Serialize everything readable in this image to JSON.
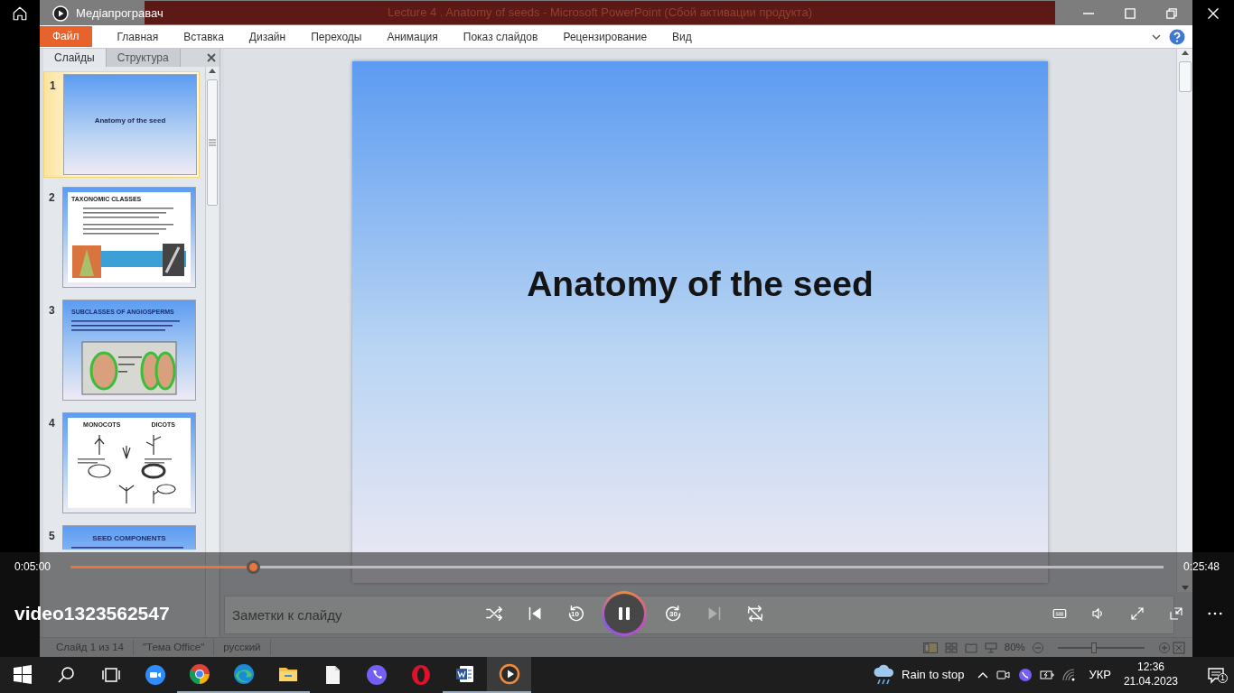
{
  "player": {
    "title": "Медіапрогравач",
    "video_title": "video1323562547",
    "elapsed": "0:05:00",
    "duration": "0:25:48",
    "level": 0.167,
    "playing": true,
    "controls": [
      {
        "kind": "shuffle",
        "disabled": false
      },
      {
        "kind": "previous",
        "disabled": false
      },
      {
        "kind": "rewind",
        "label": "10",
        "disabled": false
      },
      {
        "kind": "playpause",
        "disabled": false
      },
      {
        "kind": "forward",
        "label": "30",
        "disabled": false
      },
      {
        "kind": "next",
        "disabled": true
      },
      {
        "kind": "repeat",
        "disabled": false
      }
    ],
    "tools": [
      {
        "kind": "subtitles"
      },
      {
        "kind": "volume"
      },
      {
        "kind": "fullscreen"
      },
      {
        "kind": "miniplayer"
      },
      {
        "kind": "more"
      }
    ]
  },
  "recording": {
    "window_title": "Lecture 4 . Anatomy of seeds  -  Microsoft PowerPoint (Сбой активации продукта)",
    "ribbon_tabs": [
      {
        "label": "Файл",
        "kind": "file"
      },
      {
        "label": "Главная",
        "kind": "tab"
      },
      {
        "label": "Вставка",
        "kind": "tab"
      },
      {
        "label": "Дизайн",
        "kind": "tab"
      },
      {
        "label": "Переходы",
        "kind": "tab"
      },
      {
        "label": "Анимация",
        "kind": "tab"
      },
      {
        "label": "Показ слайдов",
        "kind": "tab"
      },
      {
        "label": "Рецензирование",
        "kind": "tab"
      },
      {
        "label": "Вид",
        "kind": "tab"
      }
    ],
    "panel_tabs": [
      {
        "label": "Слайды",
        "selected": true
      },
      {
        "label": "Структура",
        "selected": false
      }
    ],
    "slides": [
      {
        "number": "1",
        "selected": true,
        "kind": "title",
        "headings": [
          "Anatomy  of the seed"
        ]
      },
      {
        "number": "2",
        "selected": false,
        "kind": "text-photos",
        "headings": [
          "TAXONOMIC CLASSES"
        ]
      },
      {
        "number": "3",
        "selected": false,
        "kind": "diagram",
        "headings": [
          "SUBCLASSES OF ANGIOSPERMS"
        ]
      },
      {
        "number": "4",
        "selected": false,
        "kind": "sketch",
        "headings": [
          "MONOCOTS",
          "DICOTS"
        ]
      },
      {
        "number": "5",
        "selected": false,
        "kind": "bullets",
        "headings": [
          "SEED COMPONENTS"
        ]
      }
    ],
    "current_slide": {
      "title": "Anatomy of the seed"
    },
    "notes": {
      "placeholder": "Заметки к слайду"
    },
    "status_items": [
      "Слайд 1 из 14",
      "\"Тема Office\"",
      "русский"
    ],
    "zoom": {
      "label": "80%",
      "level": 0.42
    }
  },
  "taskbar": {
    "apps": [
      {
        "kind": "start",
        "running": false,
        "active": false
      },
      {
        "kind": "search",
        "running": false,
        "active": false
      },
      {
        "kind": "taskview",
        "running": false,
        "active": false
      },
      {
        "kind": "zoom",
        "running": false,
        "active": false
      },
      {
        "kind": "chrome",
        "running": true,
        "active": false
      },
      {
        "kind": "edge",
        "running": true,
        "active": false
      },
      {
        "kind": "explorer",
        "running": true,
        "active": false
      },
      {
        "kind": "notepad",
        "running": false,
        "active": false
      },
      {
        "kind": "viber",
        "running": false,
        "active": false
      },
      {
        "kind": "opera",
        "running": false,
        "active": false
      },
      {
        "kind": "word",
        "running": true,
        "active": false
      },
      {
        "kind": "player",
        "running": true,
        "active": true
      }
    ],
    "weather": "Rain to stop",
    "language": "УКР",
    "time": "12:36",
    "date": "21.04.2023",
    "notifications": "1"
  }
}
